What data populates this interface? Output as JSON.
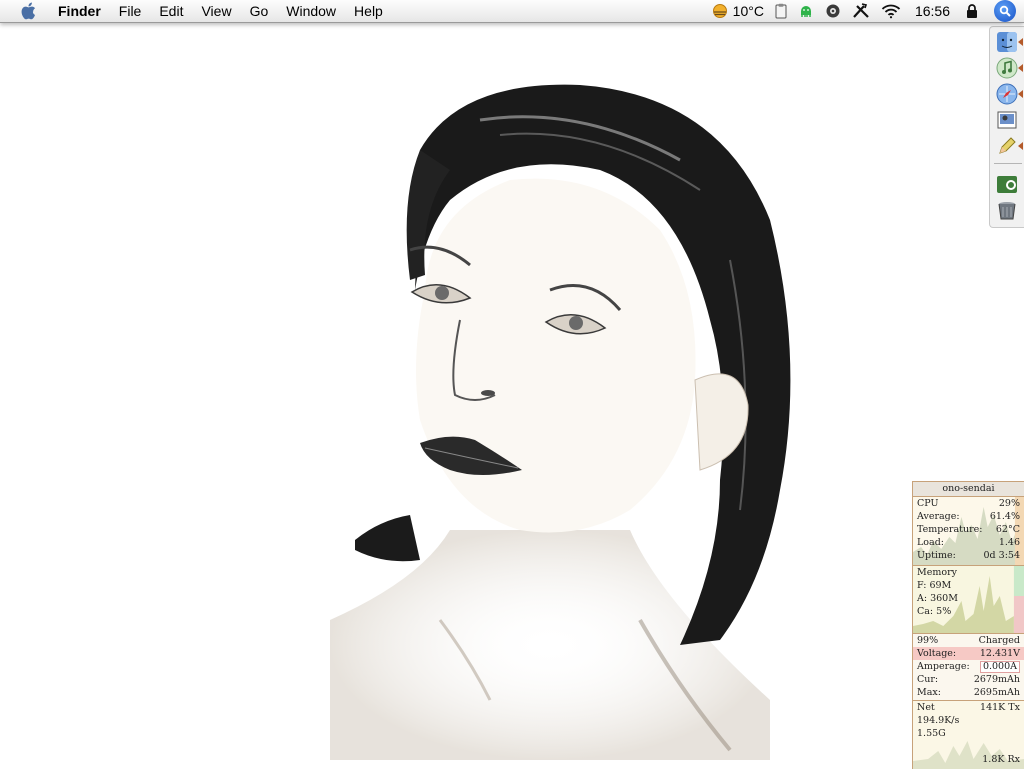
{
  "menubar": {
    "apple_icon": "apple-icon",
    "items": [
      {
        "label": "Finder",
        "bold": true
      },
      {
        "label": "File"
      },
      {
        "label": "Edit"
      },
      {
        "label": "View"
      },
      {
        "label": "Go"
      },
      {
        "label": "Window"
      },
      {
        "label": "Help"
      }
    ],
    "status": {
      "weather_temp": "10°C",
      "clock": "16:56",
      "icons": [
        "weather-icon",
        "clipboard-icon",
        "android-icon",
        "gear-icon",
        "tools-icon",
        "wifi-icon",
        "lock-icon",
        "spotlight-icon"
      ]
    }
  },
  "dock": {
    "items": [
      "finder-icon",
      "itunes-icon",
      "safari-icon",
      "preview-icon",
      "pencil-icon",
      "application-icon",
      "trash-icon"
    ]
  },
  "monitor": {
    "title": "ono-sendai",
    "cpu": {
      "label": "CPU",
      "value": "29%",
      "average_label": "Average:",
      "average": "61.4%",
      "temp_label": "Temperature:",
      "temp": "62°C",
      "load_label": "Load:",
      "load": "1.46",
      "uptime_label": "Uptime:",
      "uptime": "0d 3:54"
    },
    "memory": {
      "label": "Memory",
      "free": "F: 69M",
      "active": "A: 360M",
      "cache": "Ca: 5%"
    },
    "battery": {
      "percent": "99%",
      "status": "Charged",
      "voltage_label": "Voltage:",
      "voltage": "12.431V",
      "amperage_label": "Amperage:",
      "amperage": "0.000A",
      "cur_label": "Cur:",
      "cur": "2679mAh",
      "max_label": "Max:",
      "max": "2695mAh"
    },
    "net": {
      "label": "Net",
      "tx": "141K Tx",
      "rate": "194.9K/s",
      "total": "1.55G",
      "rx": "1.8K Rx"
    }
  },
  "colors": {
    "accent": "#1751c6",
    "monitor_border": "#c7a27a",
    "voltage_bg": "#f6c9c5"
  }
}
